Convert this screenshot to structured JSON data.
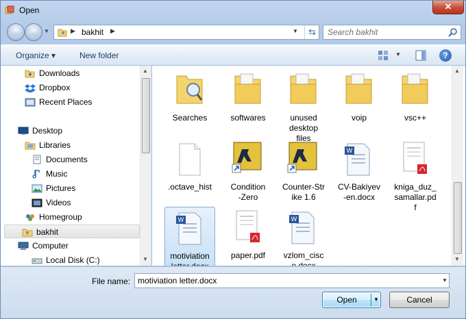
{
  "window": {
    "title": "Open"
  },
  "address": {
    "path_segment": "bakhit"
  },
  "search": {
    "placeholder": "Search bakhit"
  },
  "toolbar": {
    "organize_label": "Organize ▾",
    "new_folder_label": "New folder"
  },
  "nav_items": [
    {
      "label": "Downloads",
      "icon": "downloads-folder-icon"
    },
    {
      "label": "Dropbox",
      "icon": "dropbox-icon"
    },
    {
      "label": "Recent Places",
      "icon": "recent-places-icon"
    },
    {
      "label": "Desktop",
      "icon": "desktop-icon"
    },
    {
      "label": "Libraries",
      "icon": "libraries-icon"
    },
    {
      "label": "Documents",
      "icon": "documents-icon"
    },
    {
      "label": "Music",
      "icon": "music-icon"
    },
    {
      "label": "Pictures",
      "icon": "pictures-icon"
    },
    {
      "label": "Videos",
      "icon": "videos-icon"
    },
    {
      "label": "Homegroup",
      "icon": "homegroup-icon"
    },
    {
      "label": "bakhit",
      "icon": "user-folder-icon",
      "selected": true
    },
    {
      "label": "Computer",
      "icon": "computer-icon"
    },
    {
      "label": "Local Disk (C:)",
      "icon": "local-disk-icon"
    }
  ],
  "files": [
    {
      "name": "Searches",
      "icon": "search-folder-icon"
    },
    {
      "name": "softwares",
      "icon": "folder-icon"
    },
    {
      "name": "unused\ndesktop\nfiles",
      "icon": "folder-icon"
    },
    {
      "name": "voip",
      "icon": "folder-icon"
    },
    {
      "name": "vsc++",
      "icon": "folder-icon"
    },
    {
      "name": ".octave_hist",
      "icon": "blank-file-icon"
    },
    {
      "name": "Condition\n-Zero",
      "icon": "shortcut-icon"
    },
    {
      "name": "Counter-Str\nike 1.6",
      "icon": "shortcut-icon"
    },
    {
      "name": "CV-Bakiyev\n-en.docx",
      "icon": "word-doc-icon"
    },
    {
      "name": "kniga_duz_\nsamallar.pd\nf",
      "icon": "pdf-icon"
    },
    {
      "name": "motiviation\nletter.docx",
      "icon": "word-doc-icon",
      "selected": true
    },
    {
      "name": "paper.pdf",
      "icon": "pdf-icon"
    },
    {
      "name": "vzlom_cisc\no.docx",
      "icon": "word-doc-icon"
    }
  ],
  "bottom": {
    "file_name_label": "File name:",
    "file_name_value": "motiviation letter.docx",
    "open_label": "Open",
    "cancel_label": "Cancel"
  },
  "colors": {
    "selection": "#c6dff6",
    "window_frame": "#b3cbe8",
    "close_button": "#c9513c"
  }
}
